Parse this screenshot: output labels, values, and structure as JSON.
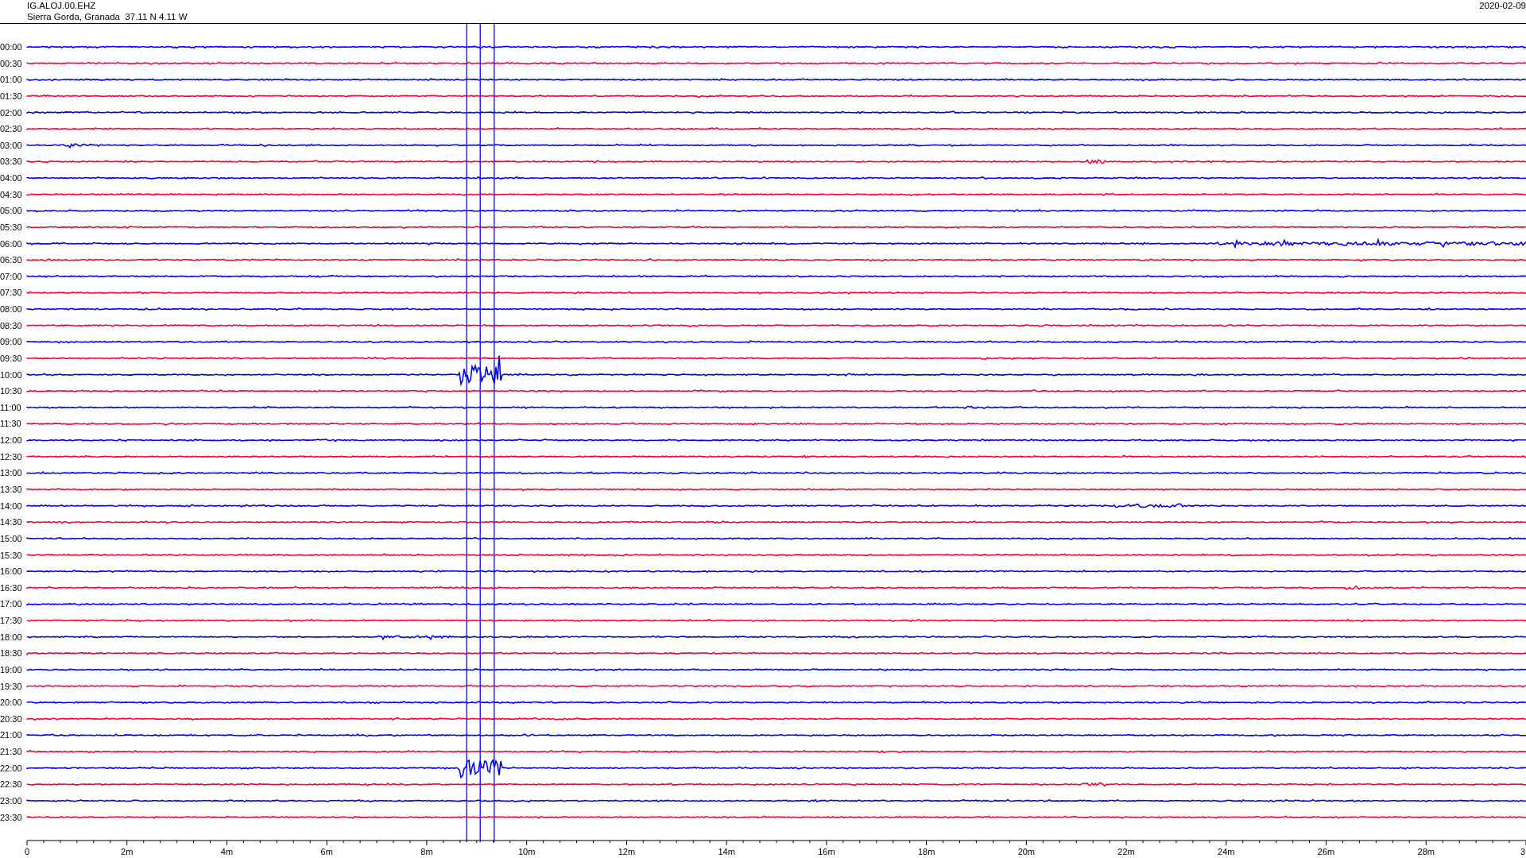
{
  "header": {
    "station": "IG.ALOJ.00.EHZ",
    "location": "Sierra Gorda, Granada  37.11 N 4.11 W",
    "date": "2020-02-09"
  },
  "traces": [
    {
      "time": "00:00",
      "color": "#0000ff"
    },
    {
      "time": "00:30",
      "color": "#ff0033"
    },
    {
      "time": "01:00",
      "color": "#0000ff"
    },
    {
      "time": "01:30",
      "color": "#ff0033"
    },
    {
      "time": "02:00",
      "color": "#0000ff"
    },
    {
      "time": "02:30",
      "color": "#ff0033"
    },
    {
      "time": "03:00",
      "color": "#0000ff"
    },
    {
      "time": "03:30",
      "color": "#ff0033"
    },
    {
      "time": "04:00",
      "color": "#0000ff"
    },
    {
      "time": "04:30",
      "color": "#ff0033"
    },
    {
      "time": "05:00",
      "color": "#0000ff"
    },
    {
      "time": "05:30",
      "color": "#ff0033"
    },
    {
      "time": "06:00",
      "color": "#0000ff"
    },
    {
      "time": "06:30",
      "color": "#ff0033"
    },
    {
      "time": "07:00",
      "color": "#0000ff"
    },
    {
      "time": "07:30",
      "color": "#ff0033"
    },
    {
      "time": "08:00",
      "color": "#0000ff"
    },
    {
      "time": "08:30",
      "color": "#ff0033"
    },
    {
      "time": "09:00",
      "color": "#0000ff"
    },
    {
      "time": "09:30",
      "color": "#ff0033"
    },
    {
      "time": "10:00",
      "color": "#0000ff"
    },
    {
      "time": "10:30",
      "color": "#ff0033"
    },
    {
      "time": "11:00",
      "color": "#0000ff"
    },
    {
      "time": "11:30",
      "color": "#ff0033"
    },
    {
      "time": "12:00",
      "color": "#0000ff"
    },
    {
      "time": "12:30",
      "color": "#ff0033"
    },
    {
      "time": "13:00",
      "color": "#0000ff"
    },
    {
      "time": "13:30",
      "color": "#ff0033"
    },
    {
      "time": "14:00",
      "color": "#0000ff"
    },
    {
      "time": "14:30",
      "color": "#ff0033"
    },
    {
      "time": "15:00",
      "color": "#0000ff"
    },
    {
      "time": "15:30",
      "color": "#ff0033"
    },
    {
      "time": "16:00",
      "color": "#0000ff"
    },
    {
      "time": "16:30",
      "color": "#ff0033"
    },
    {
      "time": "17:00",
      "color": "#0000ff"
    },
    {
      "time": "17:30",
      "color": "#ff0033"
    },
    {
      "time": "18:00",
      "color": "#0000ff"
    },
    {
      "time": "18:30",
      "color": "#ff0033"
    },
    {
      "time": "19:00",
      "color": "#0000ff"
    },
    {
      "time": "19:30",
      "color": "#ff0033"
    },
    {
      "time": "20:00",
      "color": "#0000ff"
    },
    {
      "time": "20:30",
      "color": "#ff0033"
    },
    {
      "time": "21:00",
      "color": "#0000ff"
    },
    {
      "time": "21:30",
      "color": "#ff0033"
    },
    {
      "time": "22:00",
      "color": "#0000ff"
    },
    {
      "time": "22:30",
      "color": "#ff0033"
    },
    {
      "time": "23:00",
      "color": "#0000ff"
    },
    {
      "time": "23:30",
      "color": "#ff0033"
    }
  ],
  "x_axis": {
    "labels": [
      "0",
      "2m",
      "4m",
      "6m",
      "8m",
      "10m",
      "12m",
      "14m",
      "16m",
      "18m",
      "20m",
      "22m",
      "24m",
      "26m",
      "28m",
      "3"
    ]
  }
}
